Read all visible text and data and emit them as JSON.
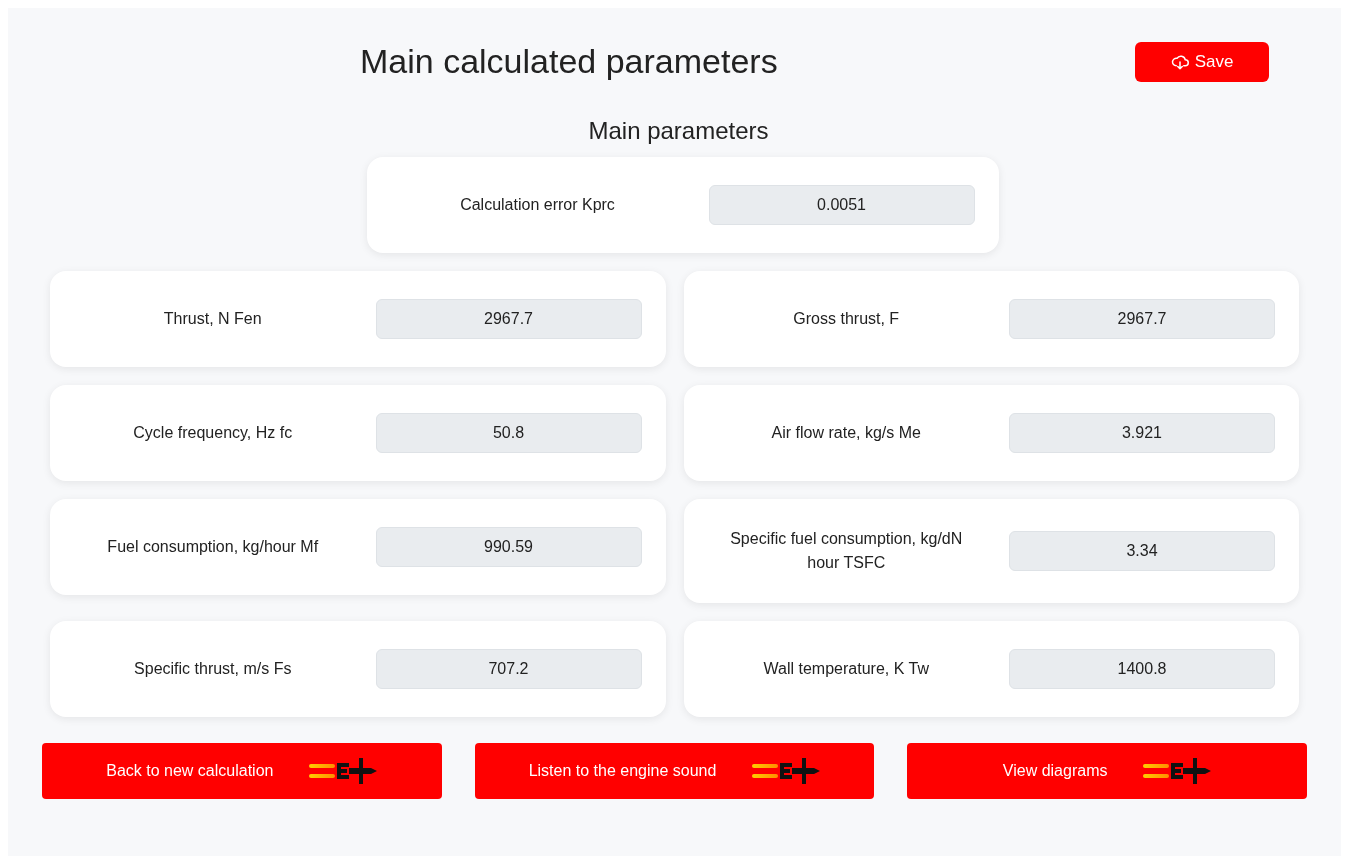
{
  "title": "Main calculated parameters",
  "save_button": {
    "label": "Save"
  },
  "section_title": "Main parameters",
  "top_parameter": {
    "label": "Calculation error Kprc",
    "value": "0.0051"
  },
  "parameters": [
    {
      "label": "Thrust, N Fen",
      "value": "2967.7"
    },
    {
      "label": "Gross thrust, F",
      "value": "2967.7"
    },
    {
      "label": "Cycle frequency, Hz fc",
      "value": "50.8"
    },
    {
      "label": "Air flow rate, kg/s Me",
      "value": "3.921"
    },
    {
      "label": "Fuel consumption, kg/hour Mf",
      "value": "990.59"
    },
    {
      "label": "Specific fuel consumption, kg/dN hour TSFC",
      "value": "3.34"
    },
    {
      "label": "Specific thrust, m/s Fs",
      "value": "707.2"
    },
    {
      "label": "Wall temperature, K Tw",
      "value": "1400.8"
    }
  ],
  "actions": [
    {
      "label": "Back to new calculation"
    },
    {
      "label": "Listen to the engine sound"
    },
    {
      "label": "View diagrams"
    }
  ]
}
